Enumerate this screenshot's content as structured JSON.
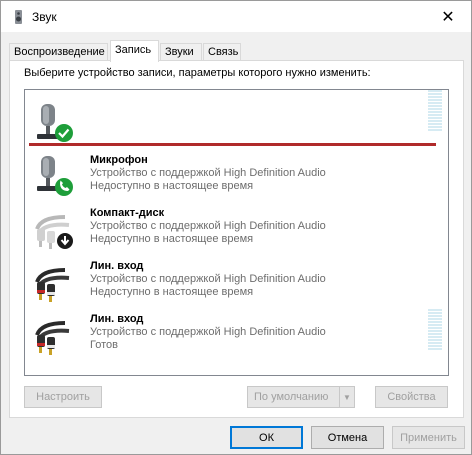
{
  "window": {
    "title": "Звук",
    "close_label": "✕"
  },
  "tabs": [
    {
      "label": "Воспроизведение"
    },
    {
      "label": "Запись"
    },
    {
      "label": "Звуки"
    },
    {
      "label": "Связь"
    }
  ],
  "panel": {
    "description": "Выберите устройство записи, параметры которого нужно изменить:"
  },
  "devices": [
    {
      "name": "",
      "line1": "",
      "line2": "",
      "status_icon": "default-check-icon",
      "meter": true
    },
    {
      "name": "Микрофон",
      "line1": "Устройство с поддержкой High Definition Audio",
      "line2": "Недоступно в настоящее время",
      "status_icon": "communication-phone-icon",
      "meter": false
    },
    {
      "name": "Компакт-диск",
      "line1": "Устройство с поддержкой High Definition Audio",
      "line2": "Недоступно в настоящее время",
      "status_icon": "unplugged-arrow-icon",
      "meter": false
    },
    {
      "name": "Лин. вход",
      "line1": "Устройство с поддержкой High Definition Audio",
      "line2": "Недоступно в настоящее время",
      "status_icon": "",
      "meter": false
    },
    {
      "name": "Лин. вход",
      "line1": "Устройство с поддержкой High Definition Audio",
      "line2": "Готов",
      "status_icon": "",
      "meter": true
    }
  ],
  "buttons": {
    "configure": "Настроить",
    "default": "По умолчанию",
    "properties": "Свойства",
    "ok": "ОК",
    "cancel": "Отмена",
    "apply": "Применить"
  },
  "colors": {
    "selection_line": "#b02a2a",
    "check_green": "#1e9e3a",
    "focus_blue": "#0078d7"
  }
}
